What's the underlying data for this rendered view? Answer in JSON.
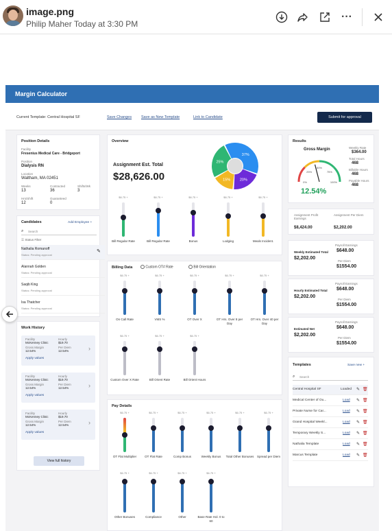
{
  "viewer": {
    "filename": "image.png",
    "sender": "Philip Maher",
    "timestamp": "Today at 3:30 PM"
  },
  "app": {
    "title": "Margin Calculator",
    "current_template_label": "Current Template: Central Hospital SF",
    "links": [
      "Save Changes",
      "Save as New Template",
      "Link to Candidate"
    ],
    "submit_label": "Submit for approval"
  },
  "position": {
    "title": "Position Details",
    "facility_label": "Facility",
    "facility": "Fresenius Medical Care - Bridgeport",
    "position_label": "Position",
    "position": "Dialysis RN",
    "location_label": "Location",
    "location": "Waltham, MA 02451",
    "stats": [
      {
        "label": "Weeks",
        "value": "13"
      },
      {
        "label": "Contracted",
        "value": "36"
      },
      {
        "label": "Shifts/Wk",
        "value": "3"
      },
      {
        "label": "Hrs/Shift",
        "value": "12"
      },
      {
        "label": "Guaranteed",
        "value": "0"
      }
    ]
  },
  "candidates": {
    "title": "Candidates",
    "add_label": "Add Employee +",
    "search_placeholder": "Search",
    "filter_label": "Status Filter",
    "items": [
      {
        "name": "Nathalia Romanoff",
        "status": "Status: Pending approval"
      },
      {
        "name": "Alannah Golden",
        "status": "Status: Pending approval"
      },
      {
        "name": "Saqib King",
        "status": "Status: Pending approval"
      },
      {
        "name": "Isa Thatcher",
        "status": "Status: Pending approval"
      }
    ]
  },
  "work_history": {
    "title": "Work History",
    "items": [
      {
        "facility_label": "Facility",
        "facility": "McKenney Clinic",
        "hourly_label": "Hourly",
        "hourly": "$19.70",
        "margin_label": "Gross Margin",
        "margin": "12.54%",
        "perdiem_label": "Per Diem",
        "perdiem": "12.54%",
        "apply": "Apply values"
      },
      {
        "facility_label": "Facility",
        "facility": "McKenney Clinic",
        "hourly_label": "Hourly",
        "hourly": "$19.70",
        "margin_label": "Gross Margin",
        "margin": "12.54%",
        "perdiem_label": "Per Diem",
        "perdiem": "12.54%",
        "apply": "Apply values"
      },
      {
        "facility_label": "Facility",
        "facility": "McKenney Clinic",
        "hourly_label": "Hourly",
        "hourly": "$19.70",
        "margin_label": "Gross Margin",
        "margin": "12.54%",
        "perdiem_label": "Per Diem",
        "perdiem": "12.54%",
        "apply": "Apply values"
      }
    ],
    "view_full_label": "View full history"
  },
  "overview": {
    "title": "Overview",
    "total_label": "Assignment Est. Total",
    "total": "$28,626.00",
    "pie": [
      {
        "label": "37%",
        "value": 37,
        "color": "#2b8ef0"
      },
      {
        "label": "20%",
        "value": 20,
        "color": "#6d2bd9"
      },
      {
        "label": "15%",
        "value": 15,
        "color": "#f2b824"
      },
      {
        "label": "25%",
        "value": 25,
        "color": "#2fb673"
      }
    ],
    "sliders": [
      {
        "top": "$6.75 +",
        "name": "Bill Regular Rate",
        "level": 0.55,
        "color": "#2fb673"
      },
      {
        "top": "$6.75 +",
        "name": "Bill Regular Rate",
        "level": 0.75,
        "color": "#2b8ef0"
      },
      {
        "top": "$6.75 +",
        "name": "Bonus",
        "level": 0.7,
        "color": "#6d2bd9"
      },
      {
        "top": "$6.75 +",
        "name": "Lodging",
        "level": 0.6,
        "color": "#f2b824"
      },
      {
        "top": "$6.75 +",
        "name": "Meals Incident.",
        "level": 0.6,
        "color": "#f2b824"
      }
    ]
  },
  "billing": {
    "title": "Billing Data",
    "opt1": "Custom OT# Rate",
    "opt2": "Bill Orientation",
    "sliders": [
      {
        "top": "$6.75 +",
        "name": "On Call Rate",
        "level": 0.7,
        "color": "#2f6fb3"
      },
      {
        "top": "$6.75 +",
        "name": "VMS %",
        "level": 0.7,
        "color": "#2f6fb3"
      },
      {
        "top": "$6.75 +",
        "name": "OT Over X",
        "level": 0.7,
        "color": "#2f6fb3"
      },
      {
        "top": "$6.75 +",
        "name": "OT Hrs. Over 8 per Day",
        "level": 0.7,
        "color": "#2f6fb3"
      },
      {
        "top": "$6.75 +",
        "name": "OT Hrs. Over 40 per Day",
        "level": 0.7,
        "color": "#2f6fb3"
      },
      {
        "top": "$6.75 +",
        "name": "Custom Over X Rate",
        "level": 0.75,
        "color": "#bdbdc7"
      },
      {
        "top": "$6.75 +",
        "name": "Bill Orient Rate",
        "level": 0.75,
        "color": "#bdbdc7"
      },
      {
        "top": "$6.75 +",
        "name": "Bill Orient Hours",
        "level": 0.75,
        "color": "#bdbdc7"
      }
    ]
  },
  "pay": {
    "title": "Pay Details",
    "sliders": [
      {
        "top": "$6.75 +",
        "name": "OT Flat Multiplier",
        "level": 0.5,
        "color": "multi"
      },
      {
        "top": "$6.75 +",
        "name": "OT Flat Rate",
        "level": 0.7,
        "color": "#2f6fb3"
      },
      {
        "top": "$6.75 +",
        "name": "Comp Bonus",
        "level": 0.7,
        "color": "#2f6fb3"
      },
      {
        "top": "$6.75 +",
        "name": "Weekly Bonus",
        "level": 0.7,
        "color": "#2f6fb3"
      },
      {
        "top": "$6.75 +",
        "name": "Total Other Bonuses",
        "level": 0.7,
        "color": "#2f6fb3"
      },
      {
        "top": "$6.75 +",
        "name": "Spread per Diem",
        "level": 0.7,
        "color": "#2f6fb3"
      },
      {
        "top": "$6.75 +",
        "name": "Other Bonuses",
        "level": 0.9,
        "color": "#2f6fb3"
      },
      {
        "top": "$6.75 +",
        "name": "Compliance",
        "level": 0.9,
        "color": "#2f6fb3"
      },
      {
        "top": "$6.75 +",
        "name": "Other",
        "level": 0.9,
        "color": "#2f6fb3"
      },
      {
        "top": "$6.75 +",
        "name": "Base Rate Hol. 0 to 60",
        "level": 0.9,
        "color": "#2f6fb3"
      }
    ]
  },
  "results": {
    "title": "Results",
    "gauge_title": "Gross Margin",
    "gauge_value": "12.54%",
    "gauge_fraction": 0.42,
    "gauge_ticks": [
      "0%",
      "25%",
      "50%",
      "75%",
      "100%"
    ],
    "side": [
      {
        "label": "Weekly Rate",
        "value": "$364.00"
      },
      {
        "label": "Total Hours",
        "value": "468"
      },
      {
        "label": "Billable Hours",
        "value": "468"
      },
      {
        "label": "Payable Hours",
        "value": "468"
      }
    ],
    "assign_profit_label": "Assignment Profit Earnings",
    "assign_profit": "$8,424.00",
    "assign_per_label": "Assignment Per Diem",
    "assign_per": "$2,202.00",
    "blocks": [
      {
        "left_label": "Weekly Estimated Total",
        "left_value": "$2,202.00",
        "r1_label": "Payroll Earnings",
        "r1_value": "$648.00",
        "r2_label": "Per Diem",
        "r2_value": "$1554.00"
      },
      {
        "left_label": "Hourly Estimated Total",
        "left_value": "$2,202.00",
        "r1_label": "Payroll Earnings",
        "r1_value": "$648.00",
        "r2_label": "Per Diem",
        "r2_value": "$1554.00"
      },
      {
        "left_label": "Estimated Net",
        "left_value": "$2,202.00",
        "r1_label": "Payroll Earnings",
        "r1_value": "$648.00",
        "r2_label": "Per Diem",
        "r2_value": "$1554.00"
      }
    ]
  },
  "templates": {
    "title": "Templates",
    "save_new_label": "Save new +",
    "search_placeholder": "Search",
    "items": [
      {
        "name": "Central Hospital SF",
        "action": "Loaded"
      },
      {
        "name": "Medical Center of Ou...",
        "action": "Load"
      },
      {
        "name": "Private Nurse for Car...",
        "action": "Load"
      },
      {
        "name": "Grand Hospital Weekl...",
        "action": "Load"
      },
      {
        "name": "Temporary Weekly S...",
        "action": "Load"
      },
      {
        "name": "Nathalia Template",
        "action": "Load"
      },
      {
        "name": "Marcus Template",
        "action": "Load"
      }
    ]
  }
}
